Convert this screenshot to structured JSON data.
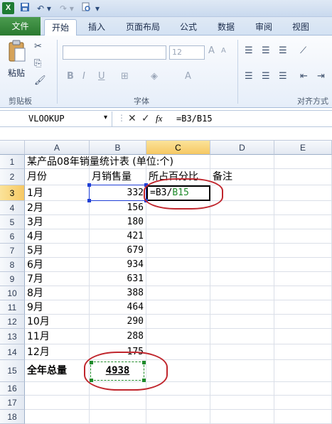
{
  "title_bar": {
    "app_logo": "X",
    "undo": "↶ ▾",
    "redo": "↷ ▾",
    "save": "💾",
    "print_preview": "🔍",
    "customize": "▾"
  },
  "tabs": [
    {
      "label": "文件"
    },
    {
      "label": "开始"
    },
    {
      "label": "插入"
    },
    {
      "label": "页面布局"
    },
    {
      "label": "公式"
    },
    {
      "label": "数据"
    },
    {
      "label": "审阅"
    },
    {
      "label": "视图"
    }
  ],
  "ribbon": {
    "clipboard": {
      "paste": "粘贴",
      "group": "剪贴板"
    },
    "font": {
      "size": "12",
      "group": "字体",
      "bold": "B",
      "italic": "I",
      "underline": "U"
    },
    "alignment": {
      "group": "对齐方式"
    }
  },
  "formula_bar": {
    "name_box": "VLOOKUP",
    "formula": "=B3/B15"
  },
  "columns": [
    "A",
    "B",
    "C",
    "D",
    "E"
  ],
  "rows": [
    {
      "n": "1",
      "a": "某产品08年销量统计表 (单位:个)",
      "b": "",
      "c": ""
    },
    {
      "n": "2",
      "a": "月份",
      "b": "月销售量",
      "c": "所占百分比",
      "d": "备注"
    },
    {
      "n": "3",
      "a": "1月",
      "b": "332",
      "c": ""
    },
    {
      "n": "4",
      "a": "2月",
      "b": "156"
    },
    {
      "n": "5",
      "a": "3月",
      "b": "180"
    },
    {
      "n": "6",
      "a": "4月",
      "b": "421"
    },
    {
      "n": "7",
      "a": "5月",
      "b": "679"
    },
    {
      "n": "8",
      "a": "6月",
      "b": "934"
    },
    {
      "n": "9",
      "a": "7月",
      "b": "631"
    },
    {
      "n": "10",
      "a": "8月",
      "b": "388"
    },
    {
      "n": "11",
      "a": "9月",
      "b": "464"
    },
    {
      "n": "12",
      "a": "10月",
      "b": "290"
    },
    {
      "n": "13",
      "a": "11月",
      "b": "288"
    },
    {
      "n": "14",
      "a": "12月",
      "b": "175"
    },
    {
      "n": "15",
      "a": "全年总量",
      "b": "4938"
    },
    {
      "n": "16"
    },
    {
      "n": "17"
    },
    {
      "n": "18"
    }
  ],
  "active_cell_edit": {
    "prefix": "=B3/",
    "ref": "B15"
  },
  "colors": {
    "accent": "#2a7a30",
    "annotation": "#c0262d",
    "ref_blue": "#1f3fd6",
    "ref_green": "#1e8a2a"
  }
}
